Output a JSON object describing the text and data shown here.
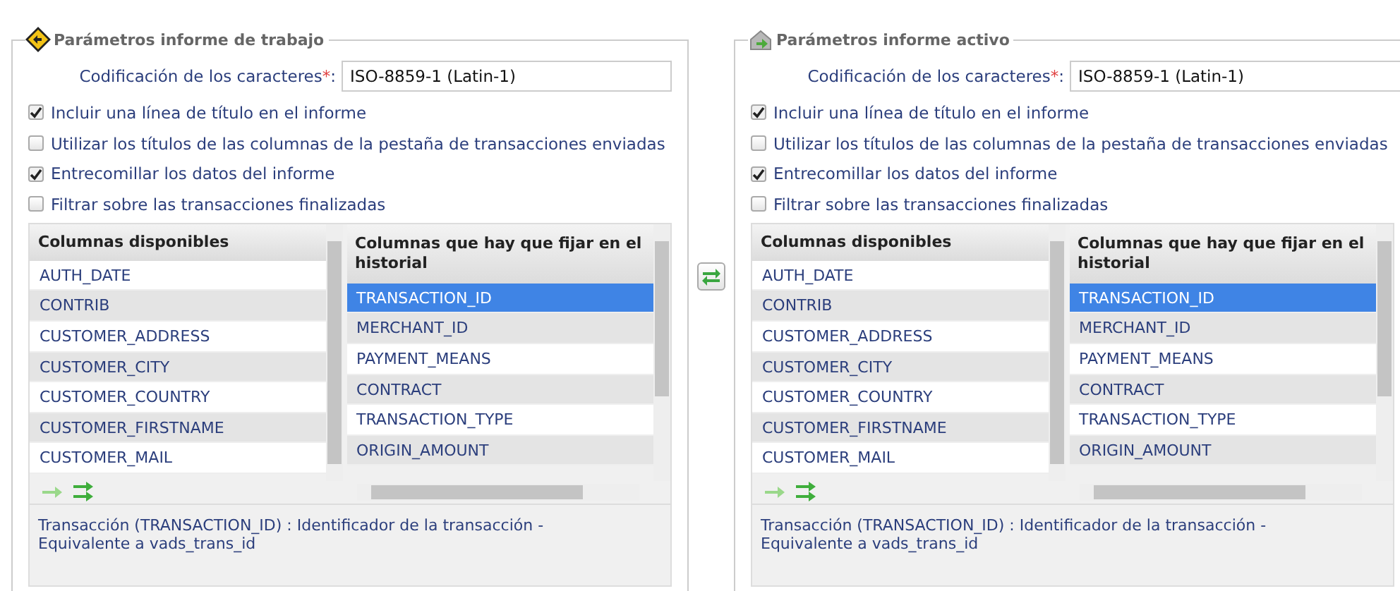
{
  "panels": [
    {
      "title": "Parámetros informe de trabajo",
      "kind": "work",
      "encoding": {
        "label": "Codificación de los caracteres",
        "required_mark": "*",
        "separator": ":",
        "value": "ISO-8859-1 (Latin-1)"
      },
      "options": [
        {
          "label": "Incluir una línea de título en el informe",
          "checked": true
        },
        {
          "label": "Utilizar los títulos de las columnas de la pestaña de transacciones enviadas",
          "checked": false
        },
        {
          "label": "Entrecomillar los datos del informe",
          "checked": true
        },
        {
          "label": "Filtrar sobre las transacciones finalizadas",
          "checked": false
        }
      ],
      "available": {
        "header": "Columnas disponibles",
        "items": [
          "AUTH_DATE",
          "CONTRIB",
          "CUSTOMER_ADDRESS",
          "CUSTOMER_CITY",
          "CUSTOMER_COUNTRY",
          "CUSTOMER_FIRSTNAME",
          "CUSTOMER_MAIL"
        ]
      },
      "chosen": {
        "header": "Columnas que hay que fijar en el historial",
        "items": [
          {
            "label": "TRANSACTION_ID",
            "selected": true
          },
          {
            "label": "MERCHANT_ID",
            "selected": false
          },
          {
            "label": "PAYMENT_MEANS",
            "selected": false
          },
          {
            "label": "CONTRACT",
            "selected": false
          },
          {
            "label": "TRANSACTION_TYPE",
            "selected": false
          },
          {
            "label": "ORIGIN_AMOUNT",
            "selected": false
          }
        ]
      },
      "description": [
        "Transacción (TRANSACTION_ID) : Identificador de la transacción -",
        "Equivalente a vads_trans_id"
      ]
    },
    {
      "title": "Parámetros informe activo",
      "kind": "active",
      "encoding": {
        "label": "Codificación de los caracteres",
        "required_mark": "*",
        "separator": ":",
        "value": "ISO-8859-1 (Latin-1)"
      },
      "options": [
        {
          "label": "Incluir una línea de título en el informe",
          "checked": true
        },
        {
          "label": "Utilizar los títulos de las columnas de la pestaña de transacciones enviadas",
          "checked": false
        },
        {
          "label": "Entrecomillar los datos del informe",
          "checked": true
        },
        {
          "label": "Filtrar sobre las transacciones finalizadas",
          "checked": false
        }
      ],
      "available": {
        "header": "Columnas disponibles",
        "items": [
          "AUTH_DATE",
          "CONTRIB",
          "CUSTOMER_ADDRESS",
          "CUSTOMER_CITY",
          "CUSTOMER_COUNTRY",
          "CUSTOMER_FIRSTNAME",
          "CUSTOMER_MAIL"
        ]
      },
      "chosen": {
        "header": "Columnas que hay que fijar en el historial",
        "items": [
          {
            "label": "TRANSACTION_ID",
            "selected": true
          },
          {
            "label": "MERCHANT_ID",
            "selected": false
          },
          {
            "label": "PAYMENT_MEANS",
            "selected": false
          },
          {
            "label": "CONTRACT",
            "selected": false
          },
          {
            "label": "TRANSACTION_TYPE",
            "selected": false
          },
          {
            "label": "ORIGIN_AMOUNT",
            "selected": false
          }
        ]
      },
      "description": [
        "Transacción (TRANSACTION_ID) : Identificador de la transacción -",
        "Equivalente a vads_trans_id"
      ]
    }
  ]
}
